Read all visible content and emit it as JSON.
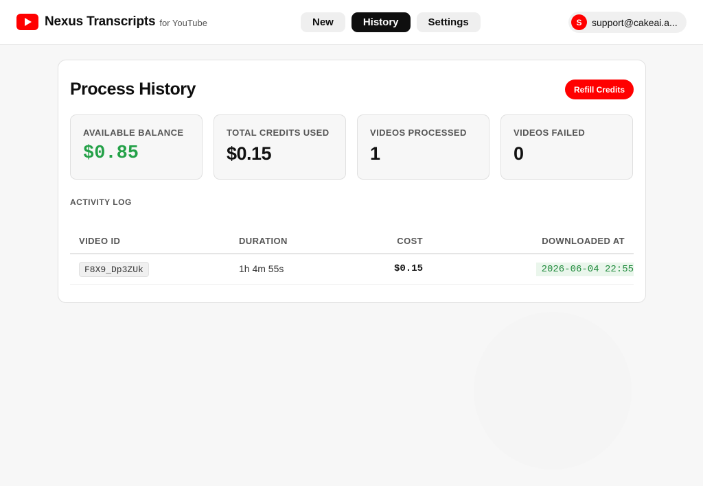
{
  "brand": {
    "name": "Nexus Transcripts",
    "sub": "for YouTube"
  },
  "nav": {
    "items": [
      "New",
      "History",
      "Settings"
    ],
    "active": "History"
  },
  "account": {
    "initial": "S",
    "email": "support@cakeai.a..."
  },
  "page": {
    "title": "Process History",
    "refill_label": "Refill Credits"
  },
  "stats": [
    {
      "label": "AVAILABLE BALANCE",
      "value": "$0.85"
    },
    {
      "label": "TOTAL CREDITS USED",
      "value": "$0.15"
    },
    {
      "label": "VIDEOS PROCESSED",
      "value": "1"
    },
    {
      "label": "VIDEOS FAILED",
      "value": "0"
    }
  ],
  "activity": {
    "label": "ACTIVITY LOG",
    "columns": [
      "VIDEO ID",
      "DURATION",
      "COST",
      "DOWNLOADED AT"
    ],
    "rows": [
      {
        "video_id": "F8X9_Dp3ZUk",
        "duration": "1h 4m 55s",
        "cost": "$0.15",
        "downloaded_at": "2026-06-04 22:55"
      }
    ]
  },
  "colors": {
    "brand_red": "#ff0000",
    "balance_green": "#24a148",
    "date_green": "#1f8a3b"
  },
  "icons": {
    "logo": "youtube-play-icon"
  }
}
